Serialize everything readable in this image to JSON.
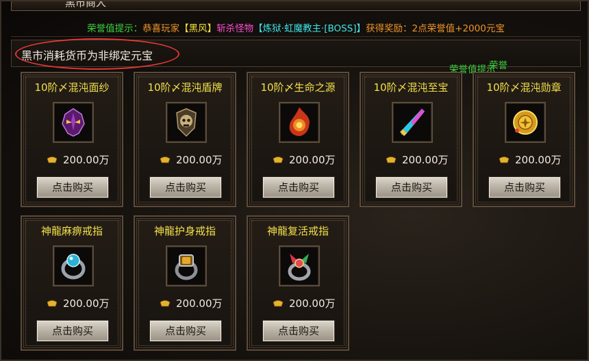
{
  "window": {
    "title": "黑市商人"
  },
  "notice": {
    "prefix": "荣誉值提示：",
    "congrats": "恭喜玩家",
    "player": "【黑风】",
    "killed": "斩杀怪物",
    "monster": "【炼狱·虹魔教主·[BOSS]】",
    "reward": "获得奖励：2点荣誉值+2000元宝"
  },
  "currency_note": "黑市消耗货币为非绑定元宝",
  "floating_text": {
    "honor_hint": "荣誉值提示",
    "honor": "荣誉"
  },
  "colors": {
    "item_name": "#f2e04a",
    "notice_green": "#3fd23f",
    "notice_orange": "#f0952a",
    "notice_pink": "#ff4fd0",
    "highlight": "#e23838"
  },
  "items": [
    {
      "name": "10阶〆混沌面纱",
      "price": "200.00万",
      "buy_label": "点击购买",
      "icon": "purple-mask-icon"
    },
    {
      "name": "10阶〆混沌盾牌",
      "price": "200.00万",
      "buy_label": "点击购买",
      "icon": "skull-shield-icon"
    },
    {
      "name": "10阶〆生命之源",
      "price": "200.00万",
      "buy_label": "点击购买",
      "icon": "flame-orb-icon"
    },
    {
      "name": "10阶〆混沌至宝",
      "price": "200.00万",
      "buy_label": "点击购买",
      "icon": "rainbow-blade-icon"
    },
    {
      "name": "10阶〆混沌勋章",
      "price": "200.00万",
      "buy_label": "点击购买",
      "icon": "gold-medal-icon"
    },
    {
      "name": "神龍麻痹戒指",
      "price": "200.00万",
      "buy_label": "点击购买",
      "icon": "blue-ring-icon"
    },
    {
      "name": "神龍护身戒指",
      "price": "200.00万",
      "buy_label": "点击购买",
      "icon": "amber-ring-icon"
    },
    {
      "name": "神龍复活戒指",
      "price": "200.00万",
      "buy_label": "点击购买",
      "icon": "phoenix-ring-icon"
    }
  ]
}
